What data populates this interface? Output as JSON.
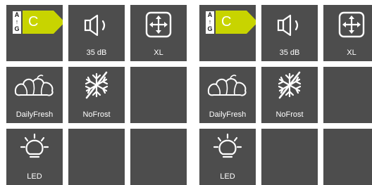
{
  "colors": {
    "tile_bg": "#4d4d4d",
    "icon_stroke": "#ffffff",
    "energy_accent": "#c8d400"
  },
  "panels": [
    {
      "energy_label": {
        "scale_top": "A",
        "scale_arrow": "↑",
        "scale_bottom": "G",
        "class": "C"
      },
      "noise": {
        "label": "35 dB",
        "icon": "speaker-icon"
      },
      "size": {
        "label": "XL",
        "icon": "move-arrows-icon"
      },
      "feature_1": {
        "label": "DailyFresh",
        "icon": "vegetables-icon"
      },
      "feature_2": {
        "label": "NoFrost",
        "icon": "no-frost-snowflake-icon"
      },
      "feature_3": {
        "label": "LED",
        "icon": "light-bulb-icon"
      }
    },
    {
      "energy_label": {
        "scale_top": "A",
        "scale_arrow": "↑",
        "scale_bottom": "G",
        "class": "C"
      },
      "noise": {
        "label": "35 dB",
        "icon": "speaker-icon"
      },
      "size": {
        "label": "XL",
        "icon": "move-arrows-icon"
      },
      "feature_1": {
        "label": "DailyFresh",
        "icon": "vegetables-icon"
      },
      "feature_2": {
        "label": "NoFrost",
        "icon": "no-frost-snowflake-icon"
      },
      "feature_3": {
        "label": "LED",
        "icon": "light-bulb-icon"
      }
    }
  ]
}
